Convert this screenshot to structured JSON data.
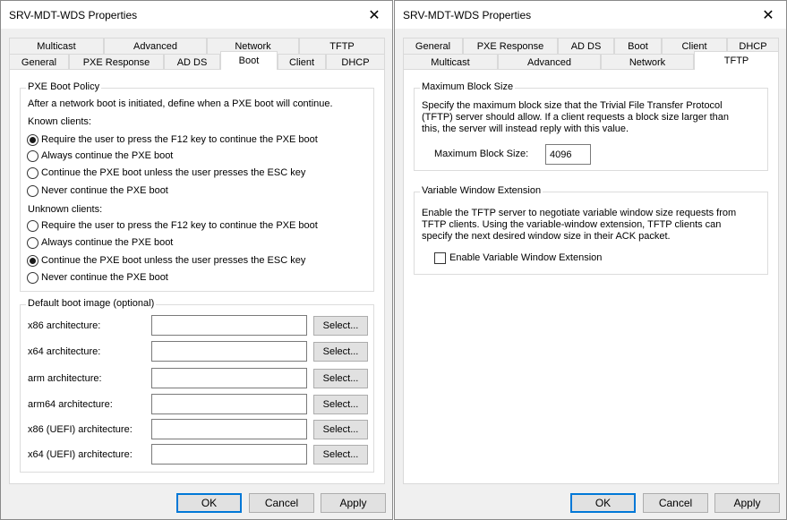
{
  "left": {
    "title": "SRV-MDT-WDS Properties",
    "tabs_row1": [
      "Multicast",
      "Advanced",
      "Network",
      "TFTP"
    ],
    "tabs_row2": [
      "General",
      "PXE Response",
      "AD DS",
      "Boot",
      "Client",
      "DHCP"
    ],
    "active_tab": "Boot",
    "pxe_group": {
      "title": "PXE Boot Policy",
      "intro": "After a network boot is initiated, define when a PXE boot will continue.",
      "known_label": "Known clients:",
      "known_options": [
        "Require the user to press the F12 key to continue the PXE boot",
        "Always continue the PXE boot",
        "Continue the PXE boot unless the user presses the ESC key",
        "Never continue the PXE boot"
      ],
      "known_selected": 0,
      "unknown_label": "Unknown clients:",
      "unknown_options": [
        "Require the user to press the F12 key to continue the PXE boot",
        "Always continue the PXE boot",
        "Continue the PXE boot unless the user presses the ESC key",
        "Never continue the PXE boot"
      ],
      "unknown_selected": 2
    },
    "boot_image_group": {
      "title": "Default boot image (optional)",
      "rows": [
        {
          "label": "x86 architecture:",
          "value": "",
          "button": "Select..."
        },
        {
          "label": "x64 architecture:",
          "value": "",
          "button": "Select..."
        },
        {
          "label": "arm architecture:",
          "value": "",
          "button": "Select..."
        },
        {
          "label": "arm64 architecture:",
          "value": "",
          "button": "Select..."
        },
        {
          "label": "x86 (UEFI) architecture:",
          "value": "",
          "button": "Select..."
        },
        {
          "label": "x64 (UEFI) architecture:",
          "value": "",
          "button": "Select..."
        }
      ]
    },
    "buttons": {
      "ok": "OK",
      "cancel": "Cancel",
      "apply": "Apply"
    }
  },
  "right": {
    "title": "SRV-MDT-WDS Properties",
    "tabs_row1": [
      "General",
      "PXE Response",
      "AD DS",
      "Boot",
      "Client",
      "DHCP"
    ],
    "tabs_row2": [
      "Multicast",
      "Advanced",
      "Network",
      "TFTP"
    ],
    "active_tab": "TFTP",
    "block_group": {
      "title": "Maximum Block Size",
      "description": "Specify the maximum block size that the Trivial File Transfer Protocol (TFTP) server should allow. If a client requests a block size larger than this, the server will instead reply with this value.",
      "field_label": "Maximum Block Size:",
      "field_value": "4096"
    },
    "window_group": {
      "title": "Variable Window Extension",
      "description": "Enable the TFTP server to negotiate variable window size requests from TFTP clients. Using the variable-window extension, TFTP clients can specify the next desired window size in their ACK packet.",
      "checkbox_label": "Enable Variable Window Extension",
      "checked": false
    },
    "buttons": {
      "ok": "OK",
      "cancel": "Cancel",
      "apply": "Apply"
    }
  },
  "icons": {
    "close": "close-icon"
  },
  "colors": {
    "accent": "#0078d7",
    "dialog_bg": "#f0f0f0",
    "panel_bg": "#ffffff"
  }
}
